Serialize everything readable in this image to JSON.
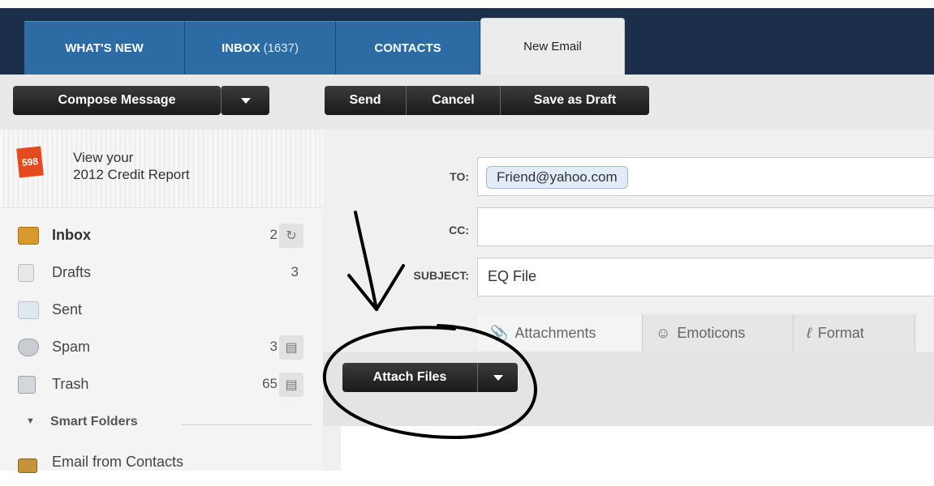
{
  "tabs": [
    {
      "label": "WHAT'S NEW"
    },
    {
      "label": "INBOX",
      "count": "(1637)"
    },
    {
      "label": "CONTACTS"
    },
    {
      "label": "New Email"
    }
  ],
  "toolbar": {
    "compose_label": "Compose Message",
    "send_label": "Send",
    "cancel_label": "Cancel",
    "save_draft_label": "Save as Draft"
  },
  "promo": {
    "logo_text": "598",
    "text": "View your\n2012 Credit Report"
  },
  "folders": [
    {
      "label": "Inbox",
      "count": "2",
      "action_icon": "refresh-icon"
    },
    {
      "label": "Drafts",
      "count": "3"
    },
    {
      "label": "Sent",
      "count": ""
    },
    {
      "label": "Spam",
      "count": "3",
      "action_icon": "trash-can-icon"
    },
    {
      "label": "Trash",
      "count": "65",
      "action_icon": "trash-can-icon"
    }
  ],
  "smart_folders": {
    "label": "Smart Folders",
    "items": [
      {
        "label": "Email from Contacts"
      }
    ]
  },
  "compose": {
    "to_label": "TO:",
    "to_value": "Friend@yahoo.com",
    "cc_label": "CC:",
    "cc_value": "",
    "subject_label": "SUBJECT:",
    "subject_value": "EQ File",
    "tools": [
      {
        "label": "Attachments",
        "icon": "paperclip-icon"
      },
      {
        "label": "Emoticons",
        "icon": "smiley-icon"
      },
      {
        "label": "Format",
        "icon": "pen-icon"
      }
    ],
    "attach_button_label": "Attach Files"
  },
  "colors": {
    "tab_blue": "#2c6ba3",
    "header_dark": "#1b2e4a",
    "button_dark": "#222222",
    "annotation": "#000000"
  }
}
